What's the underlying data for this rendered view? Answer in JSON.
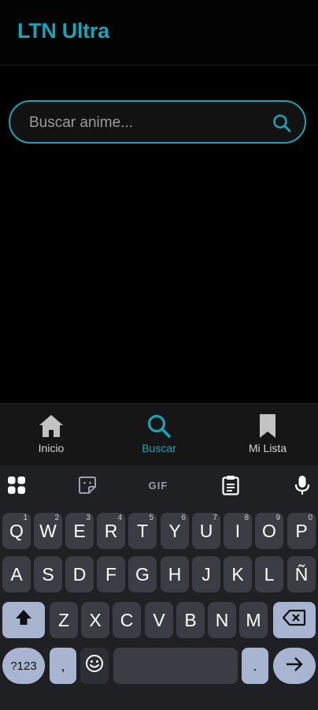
{
  "app": {
    "title": "LTN Ultra"
  },
  "search": {
    "placeholder": "Buscar anime..."
  },
  "nav": [
    {
      "label": "Inicio",
      "icon": "home-icon",
      "active": false
    },
    {
      "label": "Buscar",
      "icon": "search-icon",
      "active": true
    },
    {
      "label": "Mi Lista",
      "icon": "bookmark-icon",
      "active": false
    }
  ],
  "keyboard": {
    "toolbar": [
      "apps-icon",
      "sticker-icon",
      "GIF",
      "clipboard-icon",
      "mic-icon"
    ],
    "gif_label": "GIF",
    "row1": [
      [
        "Q",
        "1"
      ],
      [
        "W",
        "2"
      ],
      [
        "E",
        "3"
      ],
      [
        "R",
        "4"
      ],
      [
        "T",
        "5"
      ],
      [
        "Y",
        "6"
      ],
      [
        "U",
        "7"
      ],
      [
        "I",
        "8"
      ],
      [
        "O",
        "9"
      ],
      [
        "P",
        "0"
      ]
    ],
    "row2": [
      "A",
      "S",
      "D",
      "F",
      "G",
      "H",
      "J",
      "K",
      "L",
      "Ñ"
    ],
    "row3": [
      "Z",
      "X",
      "C",
      "V",
      "B",
      "N",
      "M"
    ],
    "symbols_label": "?123",
    "comma_label": ",",
    "period_label": "."
  },
  "colors": {
    "accent": "#1aa3b5",
    "background": "#000000",
    "keyboard": "#1e2024",
    "key": "#3a3d44",
    "key_accent": "#a9b4d0"
  }
}
